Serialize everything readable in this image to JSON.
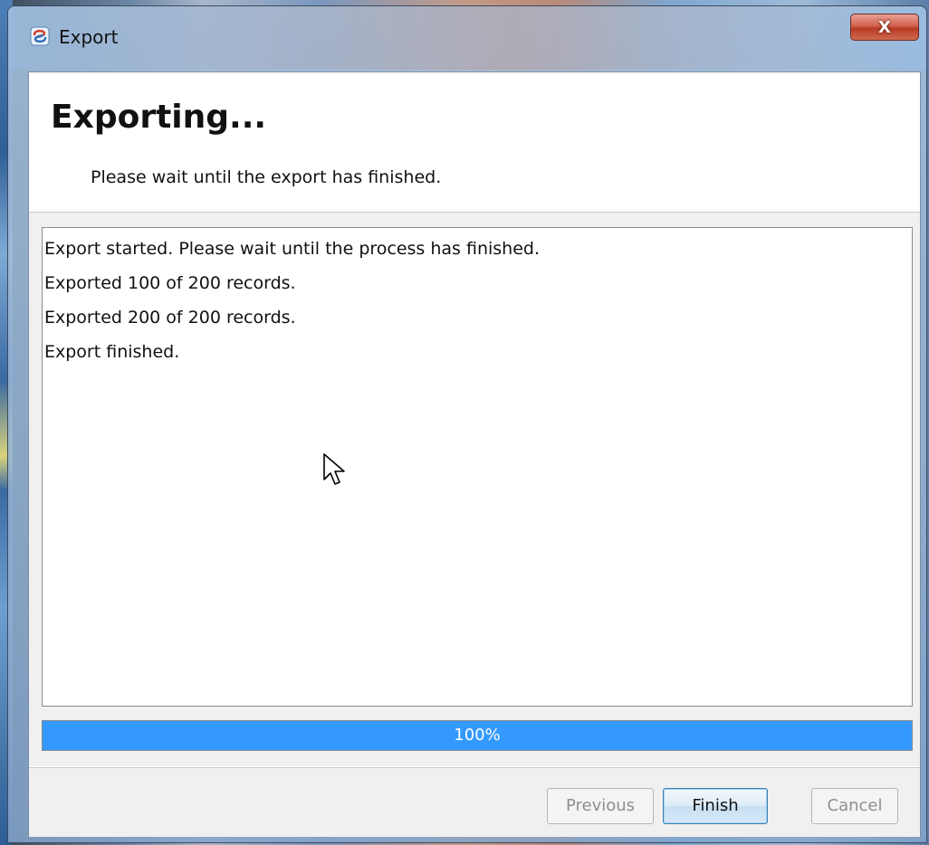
{
  "window": {
    "title": "Export",
    "close_label": "X",
    "app_icon": "export-app-icon"
  },
  "header": {
    "title": "Exporting...",
    "subtitle": "Please wait until the export has finished."
  },
  "log": {
    "lines": [
      "Export started. Please wait until the process has finished.",
      "Exported 100 of 200 records.",
      "Exported 200 of 200 records.",
      "Export finished."
    ]
  },
  "progress": {
    "value": 100,
    "label": "100%",
    "color": "#3399ff"
  },
  "buttons": {
    "previous": "Previous",
    "finish": "Finish",
    "cancel": "Cancel"
  },
  "cursor": {
    "icon": "mouse-pointer-icon"
  }
}
